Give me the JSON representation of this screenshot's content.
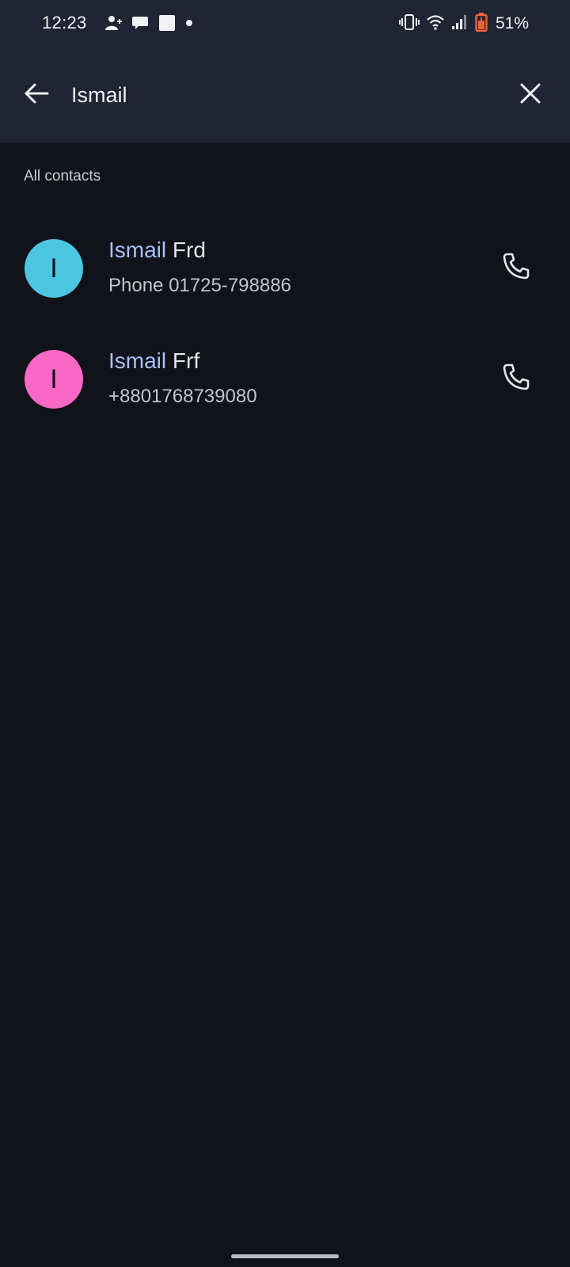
{
  "status_bar": {
    "time": "12:23",
    "left_icons": [
      "person-add-icon",
      "chat-bubble-icon",
      "square-icon",
      "dot-icon"
    ],
    "right_icons": [
      "vibrate-icon",
      "wifi-icon",
      "signal-icon",
      "battery-saver-icon"
    ],
    "battery_percent": "51%"
  },
  "search": {
    "query": "Ismail",
    "back_icon": "arrow-back-icon",
    "clear_icon": "close-icon"
  },
  "section_header": "All contacts",
  "contacts": [
    {
      "initial": "I",
      "name_match": "Ismail",
      "name_rest": " Frd",
      "detail": "Phone 01725-798886",
      "avatar_color": "#4cc5e0",
      "action_icon": "phone-icon"
    },
    {
      "initial": "I",
      "name_match": "Ismail",
      "name_rest": " Frf",
      "detail": "+8801768739080",
      "avatar_color": "#f868c4",
      "action_icon": "phone-icon"
    }
  ],
  "colors": {
    "background": "#11131b",
    "header_surface": "#212432",
    "highlight_text": "#a9c1f7",
    "battery_accent": "#f0643c"
  }
}
